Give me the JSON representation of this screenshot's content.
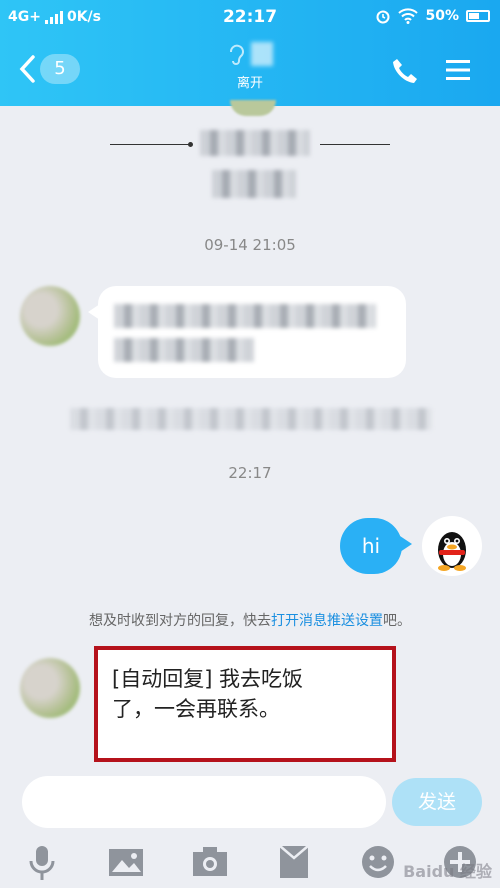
{
  "status_bar": {
    "network": "4G+",
    "speed": "0K/s",
    "time": "22:17",
    "battery": "50%"
  },
  "header": {
    "back_count": "5",
    "contact_status": "离开"
  },
  "chat": {
    "timestamps": [
      "09-14 21:05",
      "22:17"
    ],
    "sent_message": "hi",
    "notice_prefix": "想及时收到对方的回复，快去",
    "notice_link": "打开消息推送设置",
    "notice_suffix": "吧。",
    "auto_reply_line1": "[自动回复] 我去吃饭",
    "auto_reply_line2": "了，一会再联系。"
  },
  "input": {
    "placeholder": "",
    "send_label": "发送"
  },
  "toolbar": {
    "icons": [
      "microphone-icon",
      "image-icon",
      "camera-icon",
      "red-packet-icon",
      "emoji-icon",
      "plus-icon"
    ]
  },
  "watermark": "Baidu 经验",
  "colors": {
    "header_blue": "#1aa8f0",
    "bubble_blue": "#2ab0f5",
    "highlight_red": "#b5121b"
  }
}
